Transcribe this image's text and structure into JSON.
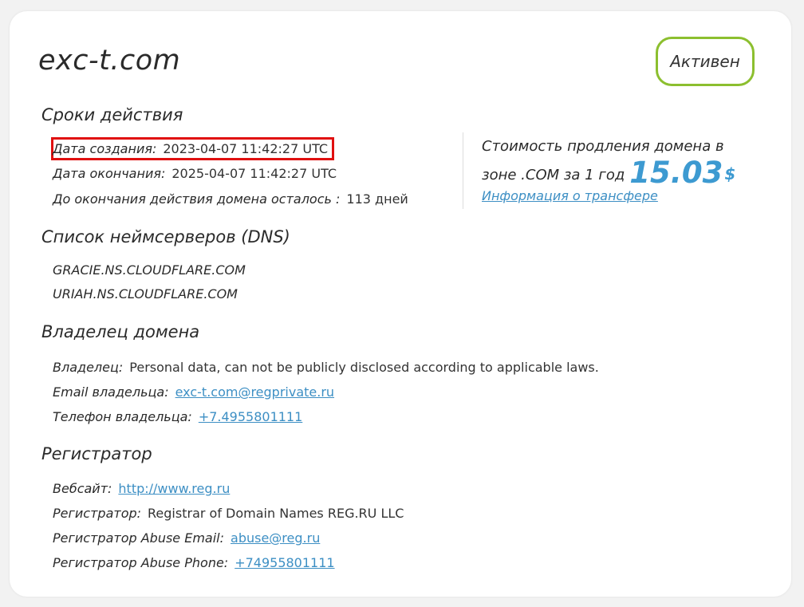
{
  "domain": "exc-t.com",
  "status": "Активен",
  "validity": {
    "title": "Сроки действия",
    "created_label": "Дата создания:",
    "created_value": "2023-04-07 11:42:27 UTC",
    "expires_label": "Дата окончания:",
    "expires_value": "2025-04-07 11:42:27 UTC",
    "remaining_label": "До окончания действия домена осталось :",
    "remaining_value": "113 дней"
  },
  "renewal": {
    "text_line1": "Стоимость продления домена в",
    "text_line2": "зоне .COM за 1 год",
    "price": "15.03",
    "currency": "$",
    "transfer_link": "Информация о трансфере"
  },
  "dns": {
    "title": "Список неймсерверов (DNS)",
    "servers": [
      "GRACIE.NS.CLOUDFLARE.COM",
      "URIAH.NS.CLOUDFLARE.COM"
    ]
  },
  "owner": {
    "title": "Владелец домена",
    "owner_label": "Владелец:",
    "owner_value": "Personal data, can not be publicly disclosed according to applicable laws.",
    "email_label": "Email владельца:",
    "email_value": "exc-t.com@regprivate.ru",
    "phone_label": "Телефон владельца:",
    "phone_value": "+7.4955801111"
  },
  "registrar": {
    "title": "Регистратор",
    "website_label": "Вебсайт:",
    "website_value": "http://www.reg.ru",
    "name_label": "Регистратор:",
    "name_value": "Registrar of Domain Names REG.RU LLC",
    "abuse_email_label": "Регистратор Abuse Email:",
    "abuse_email_value": "abuse@reg.ru",
    "abuse_phone_label": "Регистратор Abuse Phone:",
    "abuse_phone_value": "+74955801111"
  },
  "colors": {
    "accent": "#3d9ad1",
    "status_border": "#8cbf2f",
    "highlight": "#e01010"
  }
}
